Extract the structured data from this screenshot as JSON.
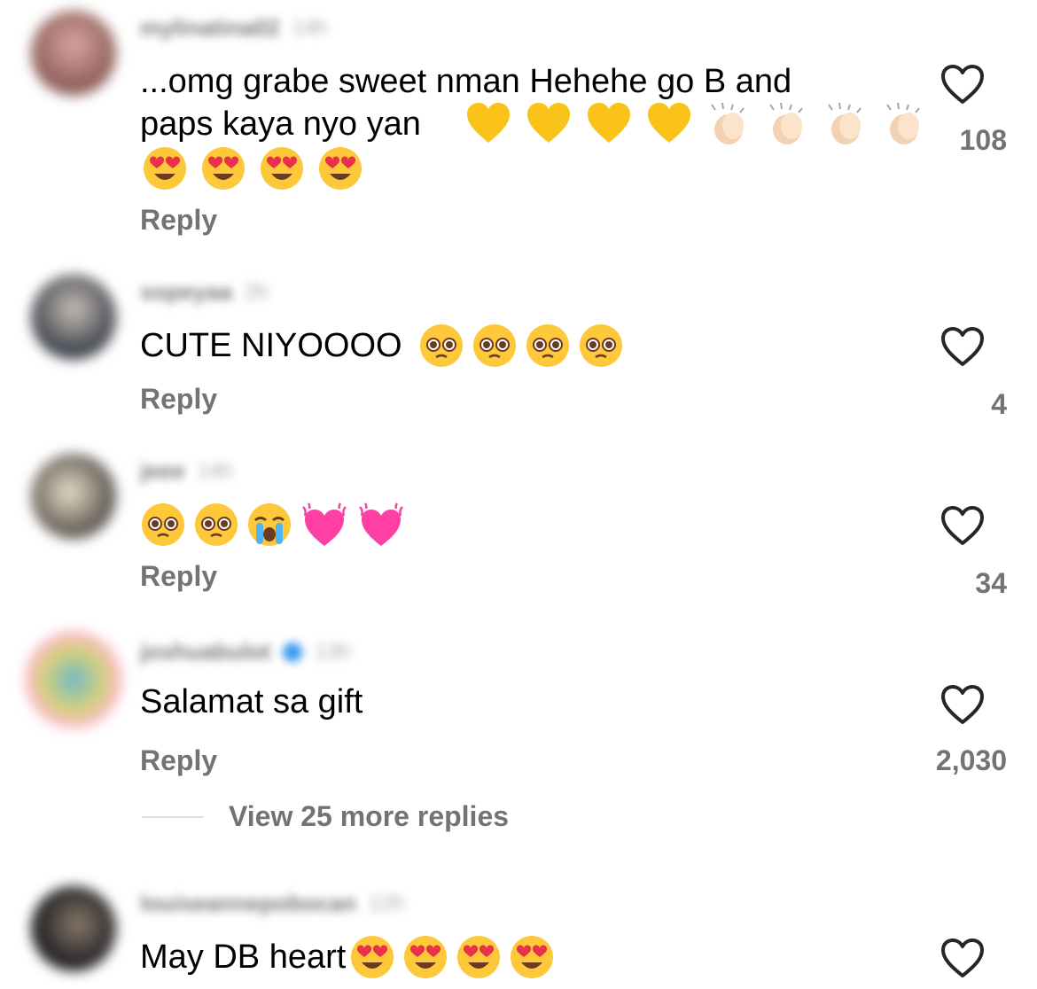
{
  "comments": [
    {
      "username": "mylinatina02",
      "time": "14h",
      "text": "...omg grabe sweet nman Hehehe go B and paps kaya nyo yan",
      "emojis": [
        "yellow-heart",
        "yellow-heart",
        "yellow-heart",
        "yellow-heart",
        "clapping-hands",
        "clapping-hands",
        "clapping-hands",
        "clapping-hands",
        "heart-eyes",
        "heart-eyes",
        "heart-eyes",
        "heart-eyes"
      ],
      "reply_label": "Reply",
      "likes": "108"
    },
    {
      "username": "sopeyaa",
      "time": "2h",
      "text": "CUTE NIYOOOO",
      "emojis": [
        "pleading-face",
        "pleading-face",
        "pleading-face",
        "pleading-face"
      ],
      "reply_label": "Reply",
      "likes": "4"
    },
    {
      "username": "jeee",
      "time": "14h",
      "text": "",
      "emojis": [
        "pleading-face",
        "pleading-face",
        "crying-face",
        "beating-heart",
        "beating-heart"
      ],
      "reply_label": "Reply",
      "likes": "34"
    },
    {
      "username": "joshuabulot",
      "time": "13h",
      "text": "Salamat sa gift",
      "emojis": [],
      "reply_label": "Reply",
      "likes": "2,030"
    },
    {
      "username": "louiseannepobocan",
      "time": "12h",
      "text": "May DB heart",
      "emojis": [
        "heart-eyes",
        "heart-eyes",
        "heart-eyes",
        "heart-eyes"
      ],
      "reply_label": "",
      "likes": ""
    }
  ],
  "view_more_replies": "View 25 more replies",
  "colors": {
    "secondary_text": "#737373",
    "heart_outline": "#262626",
    "yellow_heart": "#f9c31a",
    "pink_heart": "#ff3fa4",
    "emoji_face": "#fdc93a"
  }
}
